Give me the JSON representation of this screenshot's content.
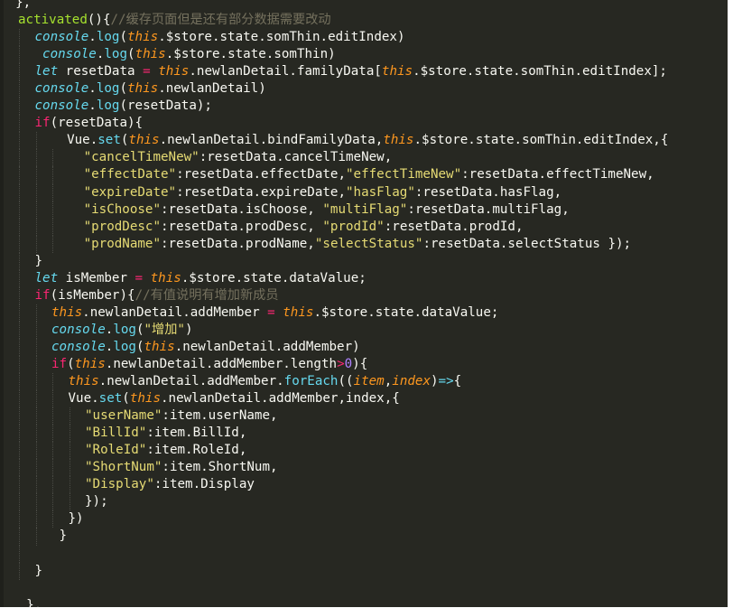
{
  "editor": {
    "colors": {
      "background": "#272822",
      "text": "#f8f8f2",
      "keyword": "#f92672",
      "this": "#fd971f",
      "console": "#66d9ef",
      "string": "#e6db74",
      "comment": "#75715e",
      "number": "#ae81ff",
      "entity": "#a6e22e"
    },
    "lines": [
      {
        "indent": 0,
        "segs": [
          [
            "plain",
            "  },"
          ]
        ]
      },
      {
        "indent": 0,
        "segs": [
          [
            "entity",
            "activated"
          ],
          [
            "plain",
            "(){"
          ],
          [
            "comment",
            "//缓存页面但是还有部分数据需要改动"
          ]
        ]
      },
      {
        "indent": 1,
        "segs": [
          [
            "console",
            "console"
          ],
          [
            "plain",
            "."
          ],
          [
            "fn",
            "log"
          ],
          [
            "plain",
            "("
          ],
          [
            "this",
            "this"
          ],
          [
            "plain",
            ".$store.state.somThin.editIndex)"
          ]
        ]
      },
      {
        "indent": 1,
        "segs": [
          [
            "plain",
            " "
          ],
          [
            "console",
            "console"
          ],
          [
            "plain",
            "."
          ],
          [
            "fn",
            "log"
          ],
          [
            "plain",
            "("
          ],
          [
            "this",
            "this"
          ],
          [
            "plain",
            ".$store.state.somThin)"
          ]
        ]
      },
      {
        "indent": 1,
        "segs": [
          [
            "storage",
            "let"
          ],
          [
            "plain",
            " resetData "
          ],
          [
            "op",
            "="
          ],
          [
            "plain",
            " "
          ],
          [
            "this",
            "this"
          ],
          [
            "plain",
            ".newlanDetail.familyData["
          ],
          [
            "this",
            "this"
          ],
          [
            "plain",
            ".$store.state.somThin.editIndex];"
          ]
        ]
      },
      {
        "indent": 1,
        "segs": [
          [
            "console",
            "console"
          ],
          [
            "plain",
            "."
          ],
          [
            "fn",
            "log"
          ],
          [
            "plain",
            "("
          ],
          [
            "this",
            "this"
          ],
          [
            "plain",
            ".newlanDetail)"
          ]
        ]
      },
      {
        "indent": 1,
        "segs": [
          [
            "console",
            "console"
          ],
          [
            "plain",
            "."
          ],
          [
            "fn",
            "log"
          ],
          [
            "plain",
            "(resetData);"
          ]
        ]
      },
      {
        "indent": 1,
        "segs": [
          [
            "kw",
            "if"
          ],
          [
            "plain",
            "(resetData){"
          ]
        ]
      },
      {
        "indent": 2,
        "segs": [
          [
            "plain",
            "  Vue."
          ],
          [
            "fn",
            "set"
          ],
          [
            "plain",
            "("
          ],
          [
            "this",
            "this"
          ],
          [
            "plain",
            ".newlanDetail.bindFamilyData,"
          ],
          [
            "this",
            "this"
          ],
          [
            "plain",
            ".$store.state.somThin.editIndex,{"
          ]
        ]
      },
      {
        "indent": 3,
        "segs": [
          [
            "plain",
            "  "
          ],
          [
            "str",
            "\"cancelTimeNew\""
          ],
          [
            "plain",
            ":resetData.cancelTimeNew,"
          ]
        ]
      },
      {
        "indent": 3,
        "segs": [
          [
            "plain",
            "  "
          ],
          [
            "str",
            "\"effectDate\""
          ],
          [
            "plain",
            ":resetData.effectDate,"
          ],
          [
            "str",
            "\"effectTimeNew\""
          ],
          [
            "plain",
            ":resetData.effectTimeNew,"
          ]
        ]
      },
      {
        "indent": 3,
        "segs": [
          [
            "plain",
            "  "
          ],
          [
            "str",
            "\"expireDate\""
          ],
          [
            "plain",
            ":resetData.expireDate,"
          ],
          [
            "str",
            "\"hasFlag\""
          ],
          [
            "plain",
            ":resetData.hasFlag,"
          ]
        ]
      },
      {
        "indent": 3,
        "segs": [
          [
            "plain",
            "  "
          ],
          [
            "str",
            "\"isChoose\""
          ],
          [
            "plain",
            ":resetData.isChoose, "
          ],
          [
            "str",
            "\"multiFlag\""
          ],
          [
            "plain",
            ":resetData.multiFlag,"
          ]
        ]
      },
      {
        "indent": 3,
        "segs": [
          [
            "plain",
            "  "
          ],
          [
            "str",
            "\"prodDesc\""
          ],
          [
            "plain",
            ":resetData.prodDesc, "
          ],
          [
            "str",
            "\"prodId\""
          ],
          [
            "plain",
            ":resetData.prodId,"
          ]
        ]
      },
      {
        "indent": 3,
        "segs": [
          [
            "plain",
            "  "
          ],
          [
            "str",
            "\"prodName\""
          ],
          [
            "plain",
            ":resetData.prodName,"
          ],
          [
            "str",
            "\"selectStatus\""
          ],
          [
            "plain",
            ":resetData.selectStatus });"
          ]
        ]
      },
      {
        "indent": 1,
        "segs": [
          [
            "plain",
            "}"
          ]
        ]
      },
      {
        "indent": 1,
        "segs": [
          [
            "storage",
            "let"
          ],
          [
            "plain",
            " isMember "
          ],
          [
            "op",
            "="
          ],
          [
            "plain",
            " "
          ],
          [
            "this",
            "this"
          ],
          [
            "plain",
            ".$store.state.dataValue;"
          ]
        ]
      },
      {
        "indent": 1,
        "segs": [
          [
            "kw",
            "if"
          ],
          [
            "plain",
            "(isMember){"
          ],
          [
            "comment",
            "//有值说明有增加新成员"
          ]
        ]
      },
      {
        "indent": 2,
        "segs": [
          [
            "this",
            "this"
          ],
          [
            "plain",
            ".newlanDetail.addMember "
          ],
          [
            "op",
            "="
          ],
          [
            "plain",
            " "
          ],
          [
            "this",
            "this"
          ],
          [
            "plain",
            ".$store.state.dataValue;"
          ]
        ]
      },
      {
        "indent": 2,
        "segs": [
          [
            "console",
            "console"
          ],
          [
            "plain",
            "."
          ],
          [
            "fn",
            "log"
          ],
          [
            "plain",
            "("
          ],
          [
            "str",
            "\"增加\""
          ],
          [
            "plain",
            ")"
          ]
        ]
      },
      {
        "indent": 2,
        "segs": [
          [
            "console",
            "console"
          ],
          [
            "plain",
            "."
          ],
          [
            "fn",
            "log"
          ],
          [
            "plain",
            "("
          ],
          [
            "this",
            "this"
          ],
          [
            "plain",
            ".newlanDetail.addMember)"
          ]
        ]
      },
      {
        "indent": 2,
        "segs": [
          [
            "kw",
            "if"
          ],
          [
            "plain",
            "("
          ],
          [
            "this",
            "this"
          ],
          [
            "plain",
            ".newlanDetail.addMember.length"
          ],
          [
            "op",
            ">"
          ],
          [
            "num",
            "0"
          ],
          [
            "plain",
            "){"
          ]
        ]
      },
      {
        "indent": 3,
        "segs": [
          [
            "this",
            "this"
          ],
          [
            "plain",
            ".newlanDetail.addMember."
          ],
          [
            "fn",
            "forEach"
          ],
          [
            "plain",
            "(("
          ],
          [
            "param",
            "item"
          ],
          [
            "plain",
            ","
          ],
          [
            "param",
            "index"
          ],
          [
            "plain",
            ")"
          ],
          [
            "storage",
            "=>"
          ],
          [
            "plain",
            "{"
          ]
        ]
      },
      {
        "indent": 3,
        "segs": [
          [
            "plain",
            "Vue."
          ],
          [
            "fn",
            "set"
          ],
          [
            "plain",
            "("
          ],
          [
            "this",
            "this"
          ],
          [
            "plain",
            ".newlanDetail.addMember,index,{"
          ]
        ]
      },
      {
        "indent": 4,
        "segs": [
          [
            "str",
            "\"userName\""
          ],
          [
            "plain",
            ":item.userName,"
          ]
        ]
      },
      {
        "indent": 4,
        "segs": [
          [
            "str",
            "\"BillId\""
          ],
          [
            "plain",
            ":item.BillId,"
          ]
        ]
      },
      {
        "indent": 4,
        "segs": [
          [
            "str",
            "\"RoleId\""
          ],
          [
            "plain",
            ":item.RoleId,"
          ]
        ]
      },
      {
        "indent": 4,
        "segs": [
          [
            "str",
            "\"ShortNum\""
          ],
          [
            "plain",
            ":item.ShortNum,"
          ]
        ]
      },
      {
        "indent": 4,
        "segs": [
          [
            "str",
            "\"Display\""
          ],
          [
            "plain",
            ":item.Display"
          ]
        ]
      },
      {
        "indent": 4,
        "segs": [
          [
            "plain",
            "});"
          ]
        ]
      },
      {
        "indent": 3,
        "segs": [
          [
            "plain",
            "})"
          ]
        ]
      },
      {
        "indent": 2,
        "segs": [
          [
            "plain",
            " }"
          ]
        ]
      },
      {
        "indent": 1,
        "segs": []
      },
      {
        "indent": 1,
        "segs": [
          [
            "plain",
            "}"
          ]
        ]
      },
      {
        "indent": 0,
        "segs": []
      },
      {
        "indent": 0,
        "segs": [
          [
            "plain",
            "  },"
          ]
        ]
      }
    ]
  }
}
